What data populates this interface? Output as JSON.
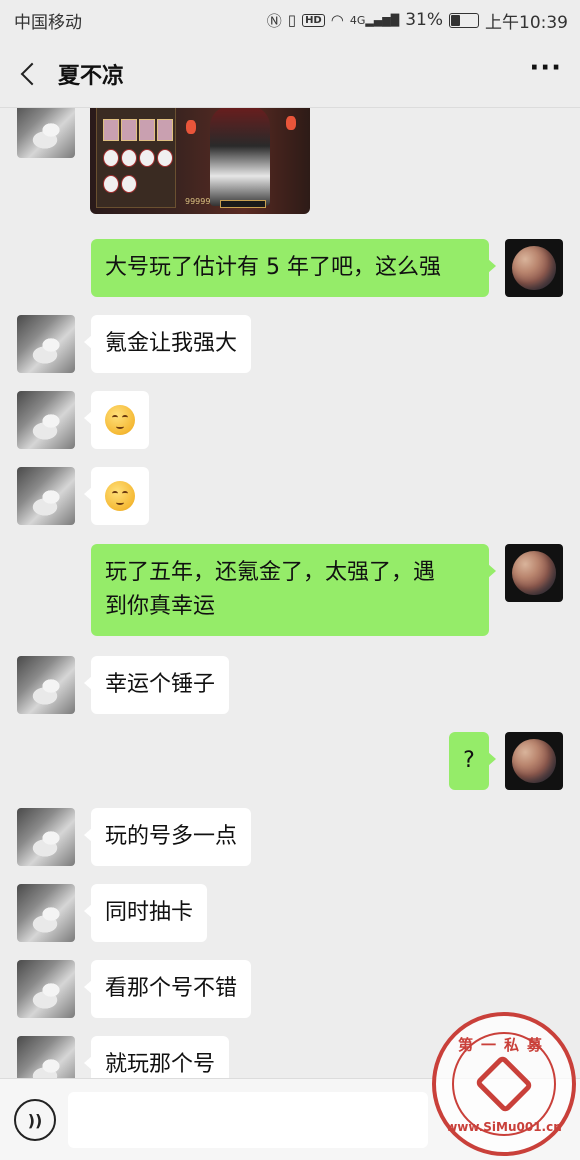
{
  "status_bar": {
    "carrier": "中国移动",
    "signal_label": "4G",
    "battery": "31%",
    "battery_level": 0.31,
    "time": "上午10:39"
  },
  "header": {
    "title": "夏不凉",
    "more": "···"
  },
  "messages": [
    {
      "side": "left",
      "type": "image",
      "avatar": "cat-avatar",
      "image_text": "99999"
    },
    {
      "side": "right",
      "type": "text",
      "avatar": "planet-avatar",
      "text": "大号玩了估计有 5 年了吧，这么强"
    },
    {
      "side": "left",
      "type": "text",
      "avatar": "cat-avatar",
      "text": "氪金让我强大"
    },
    {
      "side": "left",
      "type": "emoji",
      "avatar": "cat-avatar",
      "emoji": "smirk-face"
    },
    {
      "side": "left",
      "type": "emoji",
      "avatar": "cat-avatar",
      "emoji": "smirk-face"
    },
    {
      "side": "right",
      "type": "text",
      "avatar": "planet-avatar",
      "text_line1": "玩了五年，还氪金了，太强了，遇",
      "text_line2": "到你真幸运"
    },
    {
      "side": "left",
      "type": "text",
      "avatar": "cat-avatar",
      "text": "幸运个锤子"
    },
    {
      "side": "right",
      "type": "text",
      "avatar": "planet-avatar",
      "text": "?"
    },
    {
      "side": "left",
      "type": "text",
      "avatar": "cat-avatar",
      "text": "玩的号多一点"
    },
    {
      "side": "left",
      "type": "text",
      "avatar": "cat-avatar",
      "text": "同时抽卡"
    },
    {
      "side": "left",
      "type": "text",
      "avatar": "cat-avatar",
      "text": "看那个号不错"
    },
    {
      "side": "left",
      "type": "text",
      "avatar": "cat-avatar",
      "text": "就玩那个号"
    }
  ],
  "input_bar": {
    "voice_icon": "voice-icon",
    "voice_glyph": "))"
  },
  "watermark": {
    "top_text": "第一私募",
    "bottom_text": "www.SiMu001.cn"
  },
  "colors": {
    "background": "#ededed",
    "right_bubble": "#95ec69",
    "left_bubble": "#ffffff",
    "watermark": "#c9403a"
  }
}
